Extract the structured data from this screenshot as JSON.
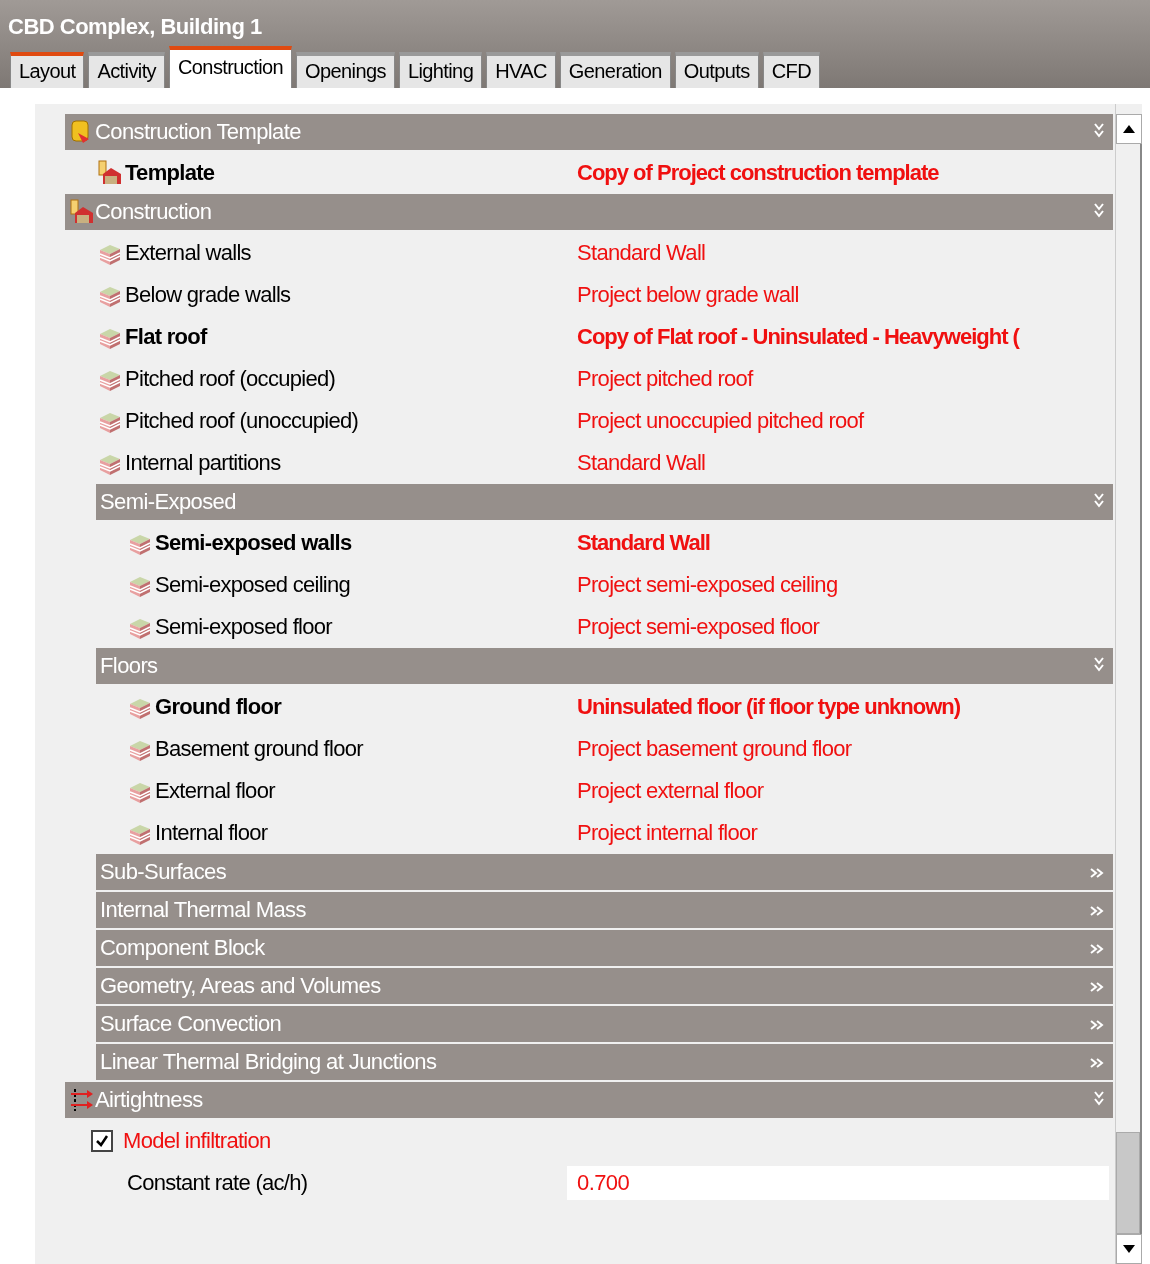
{
  "window": {
    "title": "CBD Complex, Building 1"
  },
  "tabs": [
    {
      "label": "Layout",
      "selected": false,
      "marked": true
    },
    {
      "label": "Activity",
      "selected": false,
      "marked": false
    },
    {
      "label": "Construction",
      "selected": true,
      "marked": true
    },
    {
      "label": "Openings",
      "selected": false,
      "marked": false
    },
    {
      "label": "Lighting",
      "selected": false,
      "marked": false
    },
    {
      "label": "HVAC",
      "selected": false,
      "marked": false
    },
    {
      "label": "Generation",
      "selected": false,
      "marked": false
    },
    {
      "label": "Outputs",
      "selected": false,
      "marked": false
    },
    {
      "label": "CFD",
      "selected": false,
      "marked": false
    }
  ],
  "sections": [
    {
      "title": "Construction Template",
      "expanded": true,
      "items": [
        {
          "kind": "value",
          "label": "Template",
          "value": "Copy of Project construction template",
          "bold": true
        }
      ]
    },
    {
      "title": "Construction",
      "expanded": true,
      "items": [
        {
          "kind": "value",
          "label": "External walls",
          "value": "Standard Wall",
          "bold": false
        },
        {
          "kind": "value",
          "label": "Below grade walls",
          "value": "Project below grade wall",
          "bold": false
        },
        {
          "kind": "value",
          "label": "Flat roof",
          "value": "Copy of Flat roof - Uninsulated - Heavyweight (",
          "bold": true
        },
        {
          "kind": "value",
          "label": "Pitched roof (occupied)",
          "value": "Project pitched roof",
          "bold": false
        },
        {
          "kind": "value",
          "label": "Pitched roof (unoccupied)",
          "value": "Project unoccupied pitched roof",
          "bold": false
        },
        {
          "kind": "value",
          "label": "Internal partitions",
          "value": "Standard Wall",
          "bold": false
        }
      ],
      "children": [
        {
          "title": "Semi-Exposed",
          "expanded": true,
          "items": [
            {
              "kind": "value",
              "label": "Semi-exposed walls",
              "value": "Standard Wall",
              "bold": true
            },
            {
              "kind": "value",
              "label": "Semi-exposed ceiling",
              "value": "Project semi-exposed ceiling",
              "bold": false
            },
            {
              "kind": "value",
              "label": "Semi-exposed floor",
              "value": "Project semi-exposed floor",
              "bold": false
            }
          ]
        },
        {
          "title": "Floors",
          "expanded": true,
          "items": [
            {
              "kind": "value",
              "label": "Ground floor",
              "value": "Uninsulated floor (if floor type unknown)",
              "bold": true
            },
            {
              "kind": "value",
              "label": "Basement ground floor",
              "value": "Project basement ground floor",
              "bold": false
            },
            {
              "kind": "value",
              "label": "External floor",
              "value": "Project external floor",
              "bold": false
            },
            {
              "kind": "value",
              "label": "Internal floor",
              "value": "Project internal floor",
              "bold": false
            }
          ]
        },
        {
          "title": "Sub-Surfaces",
          "expanded": false
        },
        {
          "title": "Internal Thermal Mass",
          "expanded": false
        },
        {
          "title": "Component Block",
          "expanded": false
        },
        {
          "title": "Geometry, Areas and Volumes",
          "expanded": false
        },
        {
          "title": "Surface Convection",
          "expanded": false
        },
        {
          "title": "Linear Thermal Bridging at Junctions",
          "expanded": false
        }
      ]
    },
    {
      "title": "Airtightness",
      "expanded": true,
      "items": [
        {
          "kind": "checkbox",
          "label": "Model infiltration",
          "checked": true
        },
        {
          "kind": "field",
          "label": "Constant rate (ac/h)",
          "value": "0.700"
        }
      ]
    }
  ]
}
